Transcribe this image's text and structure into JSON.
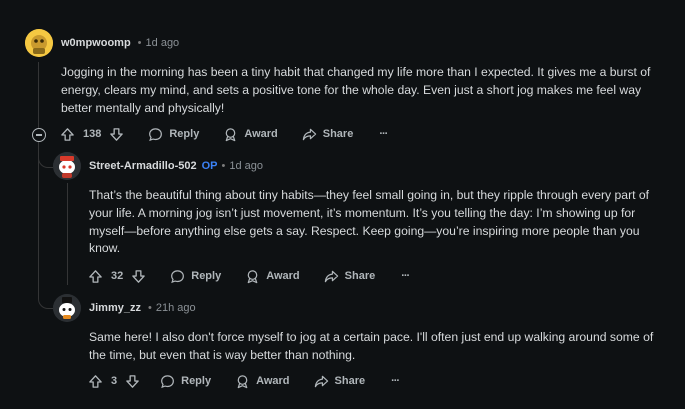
{
  "comments": [
    {
      "author": "w0mpwoomp",
      "time": "1d ago",
      "body": "Jogging in the morning has been a tiny habit that changed my life more than I expected. It gives me a burst of energy, clears my mind, and sets a positive tone for the whole day. Even just a short jog makes me feel way better mentally and physically!",
      "votes": "138",
      "reply_label": "Reply",
      "award_label": "Award",
      "share_label": "Share"
    },
    {
      "author": "Street-Armadillo-502",
      "op_badge": "OP",
      "time": "1d ago",
      "body": "That’s the beautiful thing about tiny habits—they feel small going in, but they ripple through every part of your life. A morning jog isn’t just movement, it’s momentum. It’s you telling the day: I’m showing up for myself—before anything else gets a say. Respect. Keep going—you’re inspiring more people than you know.",
      "votes": "32",
      "reply_label": "Reply",
      "award_label": "Award",
      "share_label": "Share"
    },
    {
      "author": "Jimmy_zz",
      "time": "21h ago",
      "body": "Same here! I also don't force myself to jog at a certain pace. I'll often just end up walking around some of the time, but even that is way better than nothing.",
      "votes": "3",
      "reply_label": "Reply",
      "award_label": "Award",
      "share_label": "Share"
    }
  ],
  "meta_separator": "•",
  "more_glyph": "···",
  "colors": {
    "background": "#0e1113",
    "text": "#d7dadc",
    "muted": "#8b9196",
    "op_badge": "#3b82f6",
    "thread_line": "#343536"
  }
}
